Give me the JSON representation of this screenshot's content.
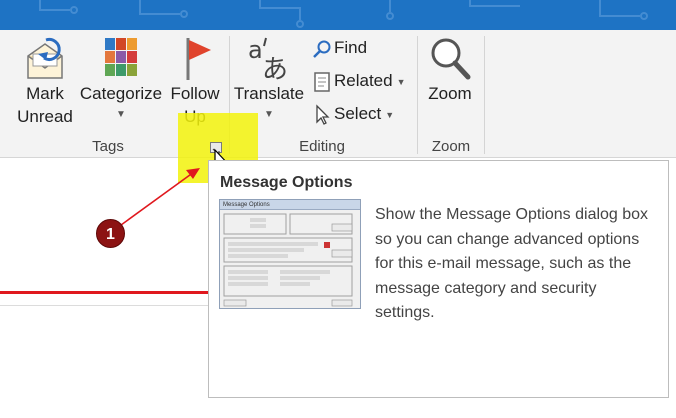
{
  "colors": {
    "titlebar": "#1e73c4",
    "highlight": "#f2f20a",
    "annotation_red": "#e0181e",
    "badge": "#8c1313"
  },
  "ribbon": {
    "tags_group": {
      "label": "Tags",
      "mark_unread": {
        "line1": "Mark",
        "line2": "Unread",
        "icon": "envelope-refresh-icon"
      },
      "categorize": {
        "label": "Categorize",
        "icon": "color-grid-icon"
      },
      "follow_up": {
        "line1": "Follow",
        "line2": "Up",
        "icon": "red-flag-icon"
      }
    },
    "editing_group": {
      "label": "Editing",
      "translate": {
        "label": "Translate",
        "icon": "translate-icon"
      },
      "find": {
        "label": "Find",
        "icon": "search-icon"
      },
      "related": {
        "label": "Related",
        "icon": "document-icon"
      },
      "select": {
        "label": "Select",
        "icon": "cursor-icon"
      }
    },
    "zoom_group": {
      "label": "Zoom",
      "zoom": {
        "label": "Zoom",
        "icon": "magnifier-icon"
      }
    }
  },
  "tooltip": {
    "title": "Message Options",
    "description": "Show the Message Options dialog box so you can change advanced options for this e-mail message, such as the message category and security settings.",
    "thumbnail_title": "Message Options"
  },
  "annotation": {
    "badge_number": "1"
  }
}
